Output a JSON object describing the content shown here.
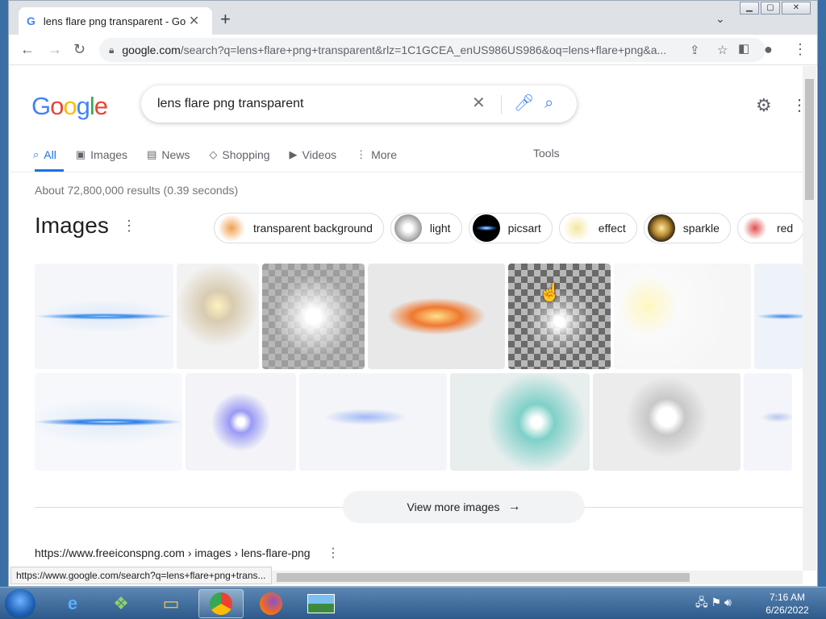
{
  "browser": {
    "tab_title": "lens flare png transparent - Goog",
    "url_domain": "google.com",
    "url_rest": "/search?q=lens+flare+png+transparent&rlz=1C1GCEA_enUS986US986&oq=lens+flare+png&a...",
    "new_tab_glyph": "+",
    "close_glyph": "✕"
  },
  "google": {
    "logo": [
      "G",
      "o",
      "o",
      "g",
      "l",
      "e"
    ],
    "logo_colors": [
      "#4285f4",
      "#ea4335",
      "#fbbc05",
      "#4285f4",
      "#34a853",
      "#ea4335"
    ],
    "query": "lens flare png transparent",
    "tabs": [
      {
        "label": "All",
        "icon": "search-icon",
        "active": true
      },
      {
        "label": "Images",
        "icon": "image-icon"
      },
      {
        "label": "News",
        "icon": "news-icon"
      },
      {
        "label": "Shopping",
        "icon": "tag-icon"
      },
      {
        "label": "Videos",
        "icon": "play-icon"
      },
      {
        "label": "More",
        "icon": "more-vert-icon"
      }
    ],
    "tools": "Tools",
    "stats": "About 72,800,000 results (0.39 seconds)",
    "images_heading": "Images",
    "chips": [
      {
        "label": "transparent background",
        "color": "#f0a050"
      },
      {
        "label": "light",
        "color": "#9a9a9a"
      },
      {
        "label": "picsart",
        "color": "#1a4fa0"
      },
      {
        "label": "effect",
        "color": "#f3e7a0"
      },
      {
        "label": "sparkle",
        "color": "#b78a30"
      },
      {
        "label": "red",
        "color": "#e05050"
      }
    ],
    "view_more": "View more images",
    "cite": "https://www.freeiconspng.com › images › lens-flare-png"
  },
  "status_url": "https://www.google.com/search?q=lens+flare+png+trans...",
  "taskbar": {
    "time": "7:16 AM",
    "date": "6/26/2022"
  }
}
